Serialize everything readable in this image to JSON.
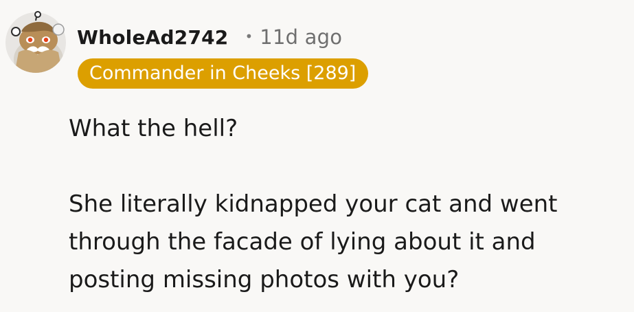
{
  "comment": {
    "author": "WholeAd2742",
    "separator": "•",
    "time_ago": "11d ago",
    "flair": "Commander in Cheeks [289]",
    "paragraph_1": "What the hell?",
    "paragraph_2_lines": [
      "She literally kidnapped your cat and went",
      "through the facade of lying about it and",
      "posting missing photos with you?"
    ]
  },
  "colors": {
    "background": "#f9f8f6",
    "flair_background": "#dc9f00",
    "username": "#1a1a1a",
    "time": "#6f6f6f"
  },
  "icons": {
    "avatar": "reddit-snoo-avatar-icon"
  }
}
